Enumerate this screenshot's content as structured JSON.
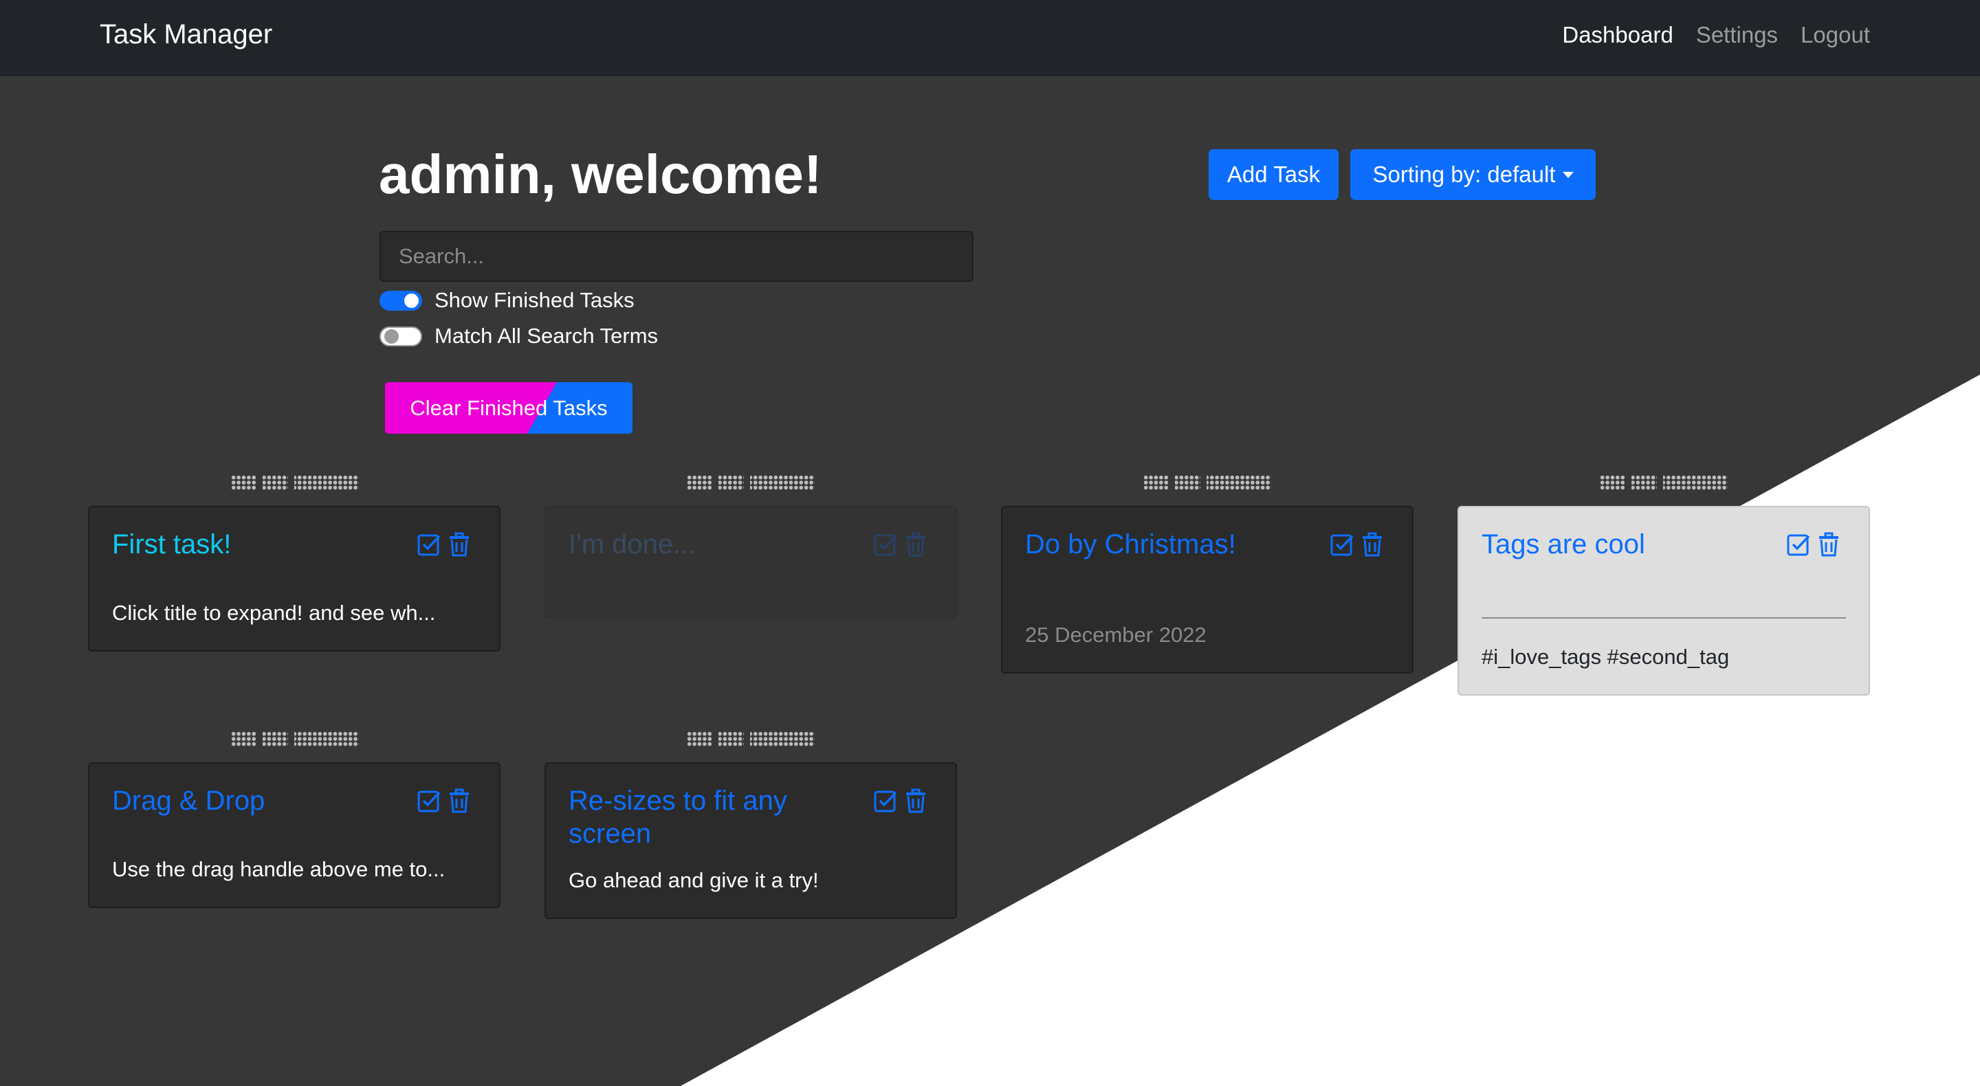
{
  "navbar": {
    "brand": "Task Manager",
    "links": [
      {
        "label": "Dashboard",
        "active": true
      },
      {
        "label": "Settings",
        "active": false
      },
      {
        "label": "Logout",
        "active": false
      }
    ]
  },
  "header": {
    "welcome": "admin, welcome!",
    "add_task_label": "Add Task",
    "sort_label": "Sorting by: default"
  },
  "search": {
    "placeholder": "Search...",
    "value": ""
  },
  "toggles": {
    "show_finished": {
      "label": "Show Finished Tasks",
      "on": true
    },
    "match_all": {
      "label": "Match All Search Terms",
      "on": false
    }
  },
  "clear_button_label": "Clear Finished Tasks",
  "colors": {
    "accent": "#0d6efd",
    "clear_button_pink": "#ee00d8",
    "background": "#373737",
    "navbar": "#212529"
  },
  "icons": {
    "complete": "check-square-icon",
    "delete": "trash-icon"
  },
  "tasks": [
    {
      "title": "First task!",
      "body": "Click title to expand! and see wh...",
      "state": "normal"
    },
    {
      "title": "I'm done...",
      "body": "",
      "state": "finished"
    },
    {
      "title": "Do by Christmas!",
      "body": "25 December 2022",
      "state": "due-date"
    },
    {
      "title": "Tags are cool",
      "body": "#i_love_tags #second_tag",
      "state": "tags"
    },
    {
      "title": "Drag & Drop",
      "body": "Use the drag handle above me to...",
      "state": "normal"
    },
    {
      "title": "Re-sizes to fit any screen",
      "body": "Go ahead and give it a try!",
      "state": "normal"
    }
  ]
}
